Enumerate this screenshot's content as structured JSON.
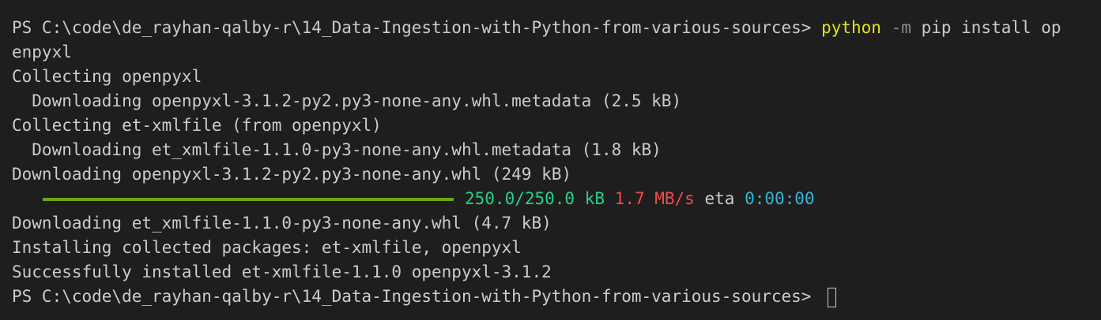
{
  "prompt_text": "PS C:\\code\\de_rayhan-qalby-r\\14_Data-Ingestion-with-Python-from-various-sources> ",
  "command": {
    "exe": "python",
    "flag": "-m",
    "rest": "pip install op",
    "wrap": "enpyxl"
  },
  "lines": {
    "l1": "Collecting openpyxl",
    "l2": "  Downloading openpyxl-3.1.2-py2.py3-none-any.whl.metadata (2.5 kB)",
    "l3": "Collecting et-xmlfile (from openpyxl)",
    "l4": "  Downloading et_xmlfile-1.1.0-py3-none-any.whl.metadata (1.8 kB)",
    "l5": "Downloading openpyxl-3.1.2-py2.py3-none-any.whl (249 kB)",
    "l7": "Downloading et_xmlfile-1.1.0-py3-none-any.whl (4.7 kB)",
    "l8": "Installing collected packages: et-xmlfile, openpyxl",
    "l9": "Successfully installed et-xmlfile-1.1.0 openpyxl-3.1.2"
  },
  "progress": {
    "fraction": 1.0,
    "size_text": "250.0/250.0 kB",
    "speed_text": "1.7 MB/s",
    "eta_label": "eta",
    "eta_value": "0:00:00",
    "colors": {
      "bar": "#6fa319",
      "size": "#23d18b",
      "speed": "#f14c4c",
      "eta": "#29b8db"
    }
  },
  "colors": {
    "background": "#1e1e1e",
    "text": "#cccccc",
    "command": "#e5e510",
    "flag": "#8a8a8a"
  }
}
